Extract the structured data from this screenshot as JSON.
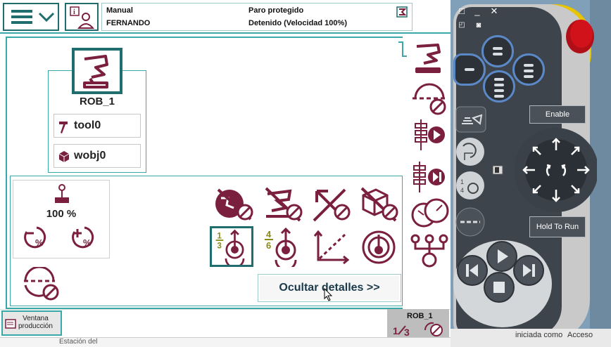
{
  "status": {
    "mode": "Manual",
    "user": "FERNANDO",
    "motors_state": "Paro protegido",
    "run_state": "Detenido (Velocidad 100%)"
  },
  "mechanical_unit": {
    "name": "ROB_1",
    "tool": "tool0",
    "workobject": "wobj0"
  },
  "speed": {
    "value": "100 %"
  },
  "buttons": {
    "hide_details": "Ocultar detalles >>",
    "production_window": "Ventana\nproducción"
  },
  "quickset_mini": {
    "unit": "ROB_1"
  },
  "pendant": {
    "enable": "Enable",
    "hold_to_run": "Hold To Run"
  },
  "background_text": {
    "left": "Estación del",
    "status": "iniciada como",
    "access": "Acceso"
  },
  "colors": {
    "accent": "#3aa8a8",
    "icon_maroon": "#7a1f3d",
    "pendant_blue": "#5b88c7",
    "yellow": "#e8c300",
    "estop_red": "#d2121a"
  }
}
